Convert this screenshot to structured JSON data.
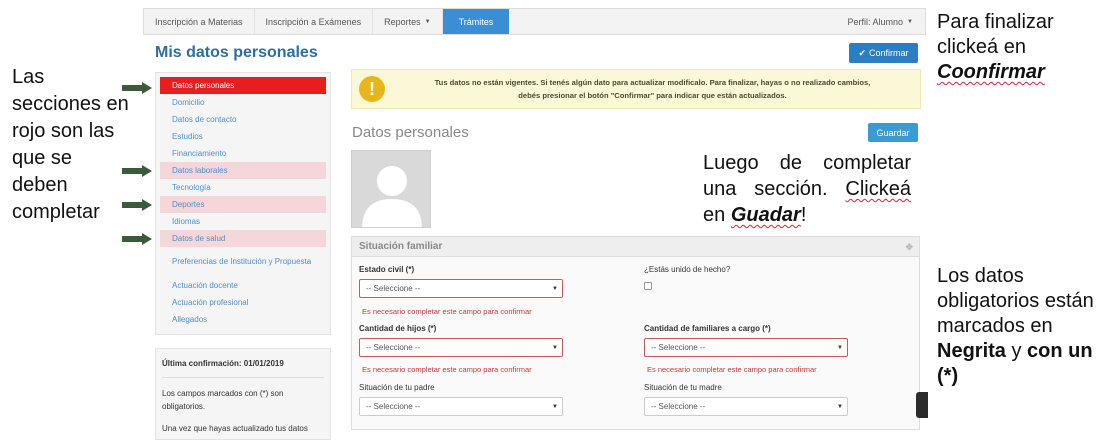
{
  "annotations": {
    "left": "Las secciones en rojo son las que se deben completar",
    "top_right_line1": "Para finalizar",
    "top_right_line2": "clickeá en",
    "top_right_bold": "Coonfirmar",
    "middle_part1": "Luego de completar una sección.",
    "middle_click": "Clickeá",
    "middle_en": "en",
    "middle_bold": "Guadar",
    "middle_end": "!",
    "bottom_right_part1": "Los datos obligatorios están marcados en",
    "bottom_right_bold1": "Negrita",
    "bottom_right_y": "y",
    "bottom_right_bold2": "con un (*)"
  },
  "navbar": {
    "items": [
      "Inscripción a Materias",
      "Inscripción a Exámenes",
      "Reportes",
      "Trámites"
    ],
    "perfil": "Perfil: Alumno"
  },
  "page_title": "Mis datos personales",
  "confirm_button": "Confirmar",
  "sidebar": {
    "items": [
      {
        "label": "Datos personales",
        "state": "red"
      },
      {
        "label": "Domicilio",
        "state": "normal"
      },
      {
        "label": "Datos de contacto",
        "state": "normal"
      },
      {
        "label": "Estudios",
        "state": "normal"
      },
      {
        "label": "Financiamiento",
        "state": "normal"
      },
      {
        "label": "Datos laborales",
        "state": "pink"
      },
      {
        "label": "Tecnología",
        "state": "normal"
      },
      {
        "label": "Deportes",
        "state": "pink"
      },
      {
        "label": "Idiomas",
        "state": "normal"
      },
      {
        "label": "Datos de salud",
        "state": "pink"
      },
      {
        "label": "Preferencias de Institución y Propuesta",
        "state": "normal"
      },
      {
        "label": "Actuación docente",
        "state": "normal"
      },
      {
        "label": "Actuación profesional",
        "state": "normal"
      },
      {
        "label": "Allegados",
        "state": "normal"
      }
    ]
  },
  "info_box": {
    "last_confirmation": "Última confirmación: 01/01/2019",
    "p1": "Los campos marcados con (*) son obligatorios.",
    "p2": "Una vez que hayas actualizado tus datos"
  },
  "warning": {
    "line1": "Tus datos no están vigentes. Si tenés algún dato para actualizar modificalo. Para finalizar, hayas o no realizado cambios,",
    "line2": "debés presionar el botón \"Confirmar\" para indicar que están actualizados."
  },
  "section_title": "Datos personales",
  "save_button": "Guardar",
  "panel": {
    "title": "Situación familiar",
    "estado_civil_label": "Estado civil (*)",
    "unido_label": "¿Estás unido de hecho?",
    "cant_hijos_label": "Cantidad de hijos (*)",
    "cant_familiares_label": "Cantidad de familiares a cargo (*)",
    "padre_label": "Situación de tu padre",
    "madre_label": "Situación de tu madre",
    "select_placeholder": "-- Seleccione --",
    "error_msg": "Es necesario completar este campo para confirmar"
  },
  "colors": {
    "accent": "#3b8ed4",
    "required_red": "#e81e1e",
    "pending_pink": "#f5d6da",
    "arrow_green": "#3b5a3a"
  }
}
